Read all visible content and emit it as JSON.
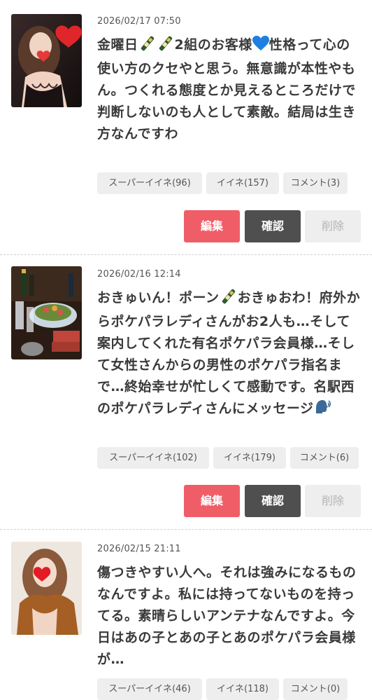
{
  "posts": [
    {
      "date": "2026/02/17 07:50",
      "text_before_bottle1": "金曜日",
      "text_between_bottles": "",
      "text_after_bottle2": "2組のお客様",
      "text_after_heart": "性格って心の使い方のクセやと思う。無意識が本性やもん。つくれる態度とか見えるところだけで判断しないのも人として素敵。結局は生き方なんですわ",
      "super_like": "スーパーイイネ(96)",
      "like": "イイネ(157)",
      "comment": "コメント(3)",
      "edit": "編集",
      "confirm": "確認",
      "delete": "削除"
    },
    {
      "date": "2026/02/16 12:14",
      "text_before_bottle": "おきゅいん！ポーン",
      "text_after_bottle": "おきゅおわ！府外からポケパラレディさんがお2人も…そして案内してくれた有名ポケパラ会員様…そして女性さんからの男性のポケパラ指名まで…終始幸せが忙しくて感動です。名駅西のポケパラレディさんにメッセージ",
      "super_like": "スーパーイイネ(102)",
      "like": "イイネ(179)",
      "comment": "コメント(6)",
      "edit": "編集",
      "confirm": "確認",
      "delete": "削除"
    },
    {
      "date": "2026/02/15 21:11",
      "text": "傷つきやすい人へ。それは強みになるものなんですよ。私には持ってないものを持ってる。素晴らしいアンテナなんですよ。今日はあの子とあの子とあのポケパラ会員様が…",
      "super_like": "スーパーイイネ(46)",
      "like": "イイネ(118)",
      "comment": "コメント(0)"
    }
  ],
  "colors": {
    "edit_button": "#ef5d67",
    "confirm_button": "#4f4f4f",
    "delete_button": "#eeeeee",
    "chip_bg": "#eeeeee"
  },
  "icons": [
    "champagne-bottle-icon",
    "blue-heart-icon",
    "speaking-head-icon",
    "red-heart-sticker-icon"
  ]
}
